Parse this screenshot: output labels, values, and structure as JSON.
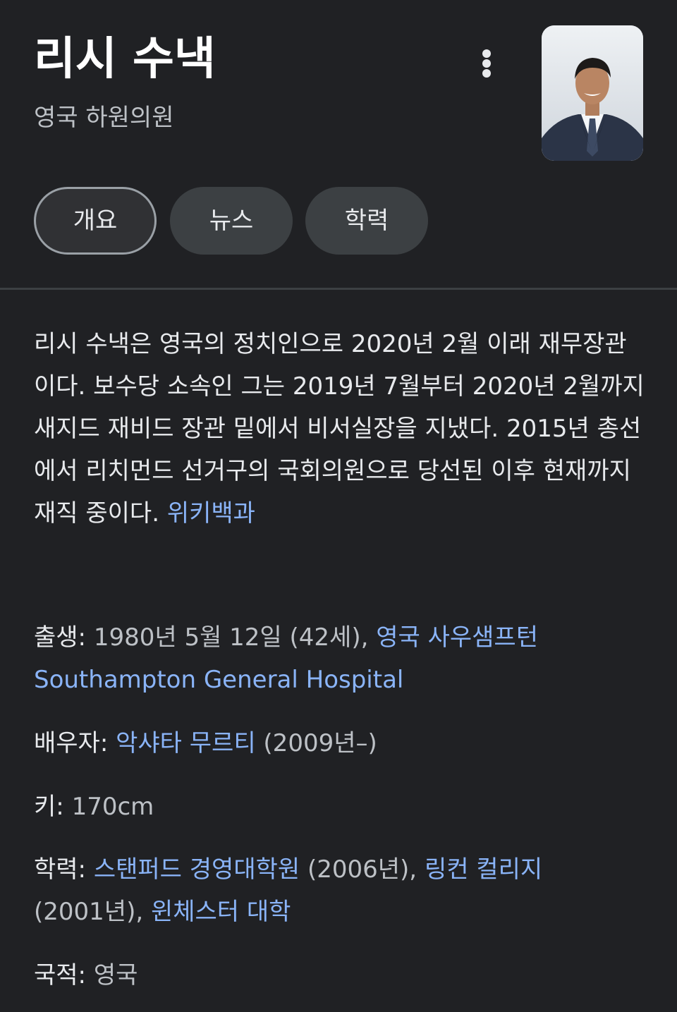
{
  "entity": {
    "name": "리시 수낵",
    "subtitle": "영국 하원의원"
  },
  "tabs": [
    {
      "label": "개요",
      "active": true
    },
    {
      "label": "뉴스",
      "active": false
    },
    {
      "label": "학력",
      "active": false
    }
  ],
  "description": {
    "text": "리시 수낵은 영국의 정치인으로 2020년 2월 이래 재무장관이다. 보수당 소속인 그는 2019년 7월부터 2020년 2월까지 새지드 재비드 장관 밑에서 비서실장을 지냈다. 2015년 총선에서 리치먼드 선거구의 국회의원으로 당선된 이후 현재까지 재직 중이다. ",
    "source_link": "위키백과"
  },
  "facts": {
    "birth": {
      "label": "출생:",
      "value": "1980년 5월 12일 (42세),",
      "place_link": "영국 사우샘프턴",
      "hospital_link": "Southampton General Hospital"
    },
    "spouse": {
      "label": "배우자:",
      "name_link": "악샤타 무르티",
      "years": "(2009년–)"
    },
    "height": {
      "label": "키:",
      "value": "170cm"
    },
    "education": {
      "label": "학력:",
      "school1_link": "스탠퍼드 경영대학원",
      "school1_year": "(2006년),",
      "school2_link": "링컨 컬리지",
      "school2_year": "(2001년),",
      "school3_link": "윈체스터 대학"
    },
    "nationality": {
      "label": "국적:",
      "value": "영국"
    }
  },
  "colors": {
    "background": "#202124",
    "text": "#e8eaed",
    "muted_text": "#bdc1c6",
    "link": "#8ab4f8",
    "chip": "#3c4043"
  },
  "icons": {
    "more": "more-vert-icon"
  }
}
